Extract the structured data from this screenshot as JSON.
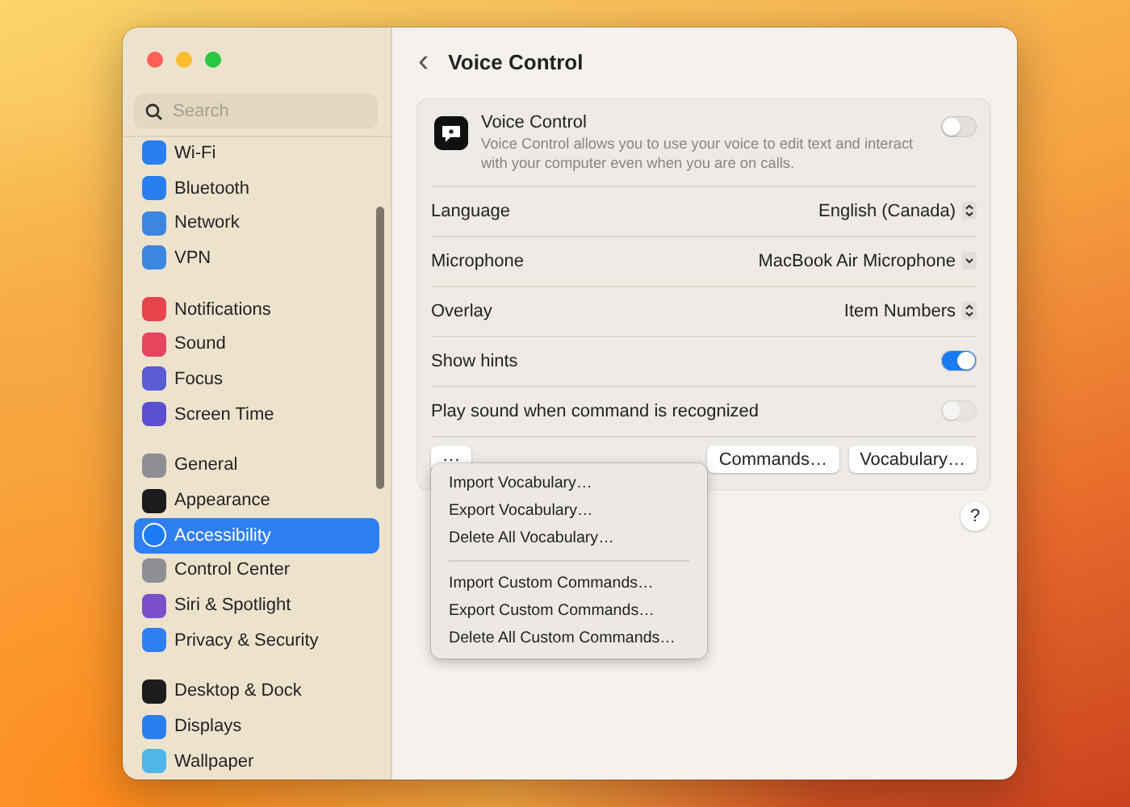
{
  "window": {
    "controls": [
      {
        "color": "#ff5f57"
      },
      {
        "color": "#febc2e"
      },
      {
        "color": "#28c840"
      }
    ]
  },
  "sidebar": {
    "search": {
      "placeholder": "Search"
    },
    "groups": [
      {
        "items": [
          {
            "label": "Wi-Fi",
            "color": "#2a7ff0",
            "selected": false
          },
          {
            "label": "Bluetooth",
            "color": "#2a7ff0",
            "selected": false
          },
          {
            "label": "Network",
            "color": "#3d86e0",
            "selected": false
          },
          {
            "label": "VPN",
            "color": "#3d86e0",
            "selected": false
          }
        ]
      },
      {
        "items": [
          {
            "label": "Notifications",
            "color": "#e8444d",
            "selected": false
          },
          {
            "label": "Sound",
            "color": "#e8445e",
            "selected": false
          },
          {
            "label": "Focus",
            "color": "#5b5bd6",
            "selected": false
          },
          {
            "label": "Screen Time",
            "color": "#5b4fcf",
            "selected": false
          }
        ]
      },
      {
        "items": [
          {
            "label": "General",
            "color": "#8e8e93",
            "selected": false
          },
          {
            "label": "Appearance",
            "color": "#1c1c1e",
            "selected": false
          },
          {
            "label": "Accessibility",
            "color": "#1a7cf5",
            "selected": true
          },
          {
            "label": "Control Center",
            "color": "#8e8e93",
            "selected": false
          },
          {
            "label": "Siri & Spotlight",
            "color": "#7b4fc9",
            "selected": false
          },
          {
            "label": "Privacy & Security",
            "color": "#2f7ff0",
            "selected": false
          }
        ]
      },
      {
        "items": [
          {
            "label": "Desktop & Dock",
            "color": "#1c1c1e",
            "selected": false
          },
          {
            "label": "Displays",
            "color": "#2a7ff0",
            "selected": false
          },
          {
            "label": "Wallpaper",
            "color": "#4fb6e8",
            "selected": false
          }
        ]
      }
    ]
  },
  "pane": {
    "back": "‹",
    "title": "Voice Control",
    "feature": {
      "title": "Voice Control",
      "description": "Voice Control allows you to use your voice to edit text and interact with your computer even when you are on calls.",
      "on": false
    },
    "settings": [
      {
        "kind": "popup",
        "label": "Language",
        "value": "English (Canada)"
      },
      {
        "kind": "dropdown",
        "label": "Microphone",
        "value": "MacBook Air Microphone"
      },
      {
        "kind": "popup",
        "label": "Overlay",
        "value": "Item Numbers"
      },
      {
        "kind": "toggle",
        "label": "Show hints",
        "on": true,
        "disabled": false
      },
      {
        "kind": "toggle",
        "label": "Play sound when command is recognized",
        "on": false,
        "disabled": true
      }
    ],
    "more_button": "···",
    "buttons": [
      "Commands…",
      "Vocabulary…"
    ],
    "help": "?"
  },
  "menu": {
    "sections": [
      {
        "items": [
          "Import Vocabulary…",
          "Export Vocabulary…",
          "Delete All Vocabulary…"
        ]
      },
      {
        "items": [
          "Import Custom Commands…",
          "Export Custom Commands…",
          "Delete All Custom Commands…"
        ]
      }
    ]
  }
}
